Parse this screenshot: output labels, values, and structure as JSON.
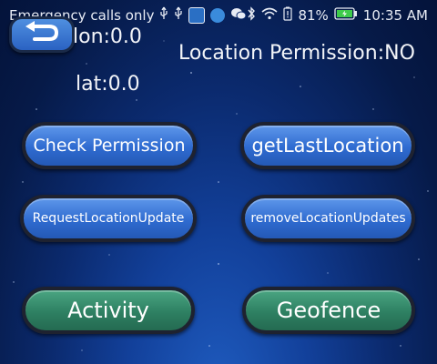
{
  "status_bar": {
    "carrier_text": "Emergency calls only",
    "battery": "81%",
    "time": "10:35 AM"
  },
  "location": {
    "lon_text": "lon:0.0",
    "lat_text": "lat:0.0",
    "permission_text": "Location Permission:NO"
  },
  "buttons": {
    "check_permission": "Check Permission",
    "get_last_location": "getLastLocation",
    "request_location_update": "RequestLocationUpdate",
    "remove_location_updates": "removeLocationUpdates",
    "activity": "Activity",
    "geofence": "Geofence"
  },
  "colors": {
    "blue_button": "#2f6bd0",
    "green_button": "#2e8062",
    "battery_green": "#3ecb4a"
  },
  "icons": [
    "usb-icon",
    "usb-icon",
    "app-notification-icon",
    "app-notification-icon",
    "wechat-icon",
    "bluetooth-icon",
    "wifi-icon",
    "battery-saver-icon",
    "battery-icon",
    "back-arrow-icon"
  ]
}
